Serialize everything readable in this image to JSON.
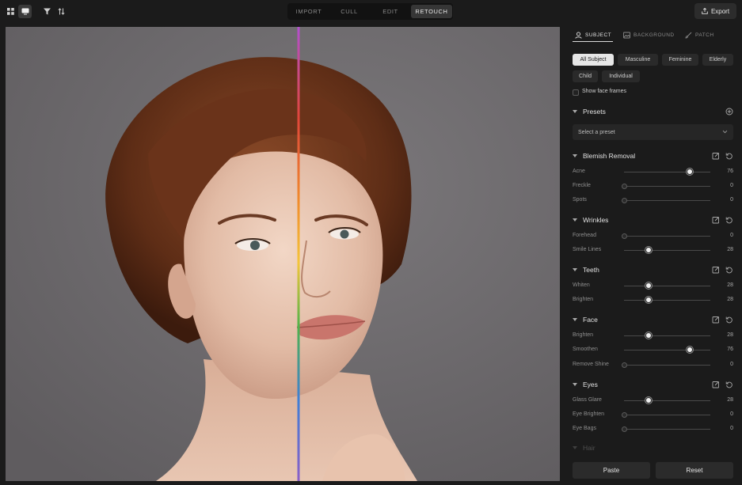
{
  "toolbar": {
    "left_icons": [
      "grid-view-icon",
      "single-view-icon",
      "filter-icon",
      "sort-icon"
    ],
    "modes": [
      {
        "label": "IMPORT",
        "active": false
      },
      {
        "label": "CULL",
        "active": false
      },
      {
        "label": "EDIT",
        "active": false
      },
      {
        "label": "RETOUCH",
        "active": true
      }
    ],
    "export_label": "Export"
  },
  "canvas": {
    "split_line_colors": [
      "#e0463a",
      "#f08a2c",
      "#f4c53a",
      "#4fb34a",
      "#3f7fd6",
      "#8a5fc8"
    ]
  },
  "panel": {
    "tabs": [
      {
        "label": "SUBJECT",
        "icon": "person-icon",
        "active": true
      },
      {
        "label": "BACKGROUND",
        "icon": "image-icon",
        "active": false
      },
      {
        "label": "PATCH",
        "icon": "brush-icon",
        "active": false
      }
    ],
    "subject_chips": [
      {
        "label": "All Subject",
        "active": true
      },
      {
        "label": "Masculine",
        "active": false
      },
      {
        "label": "Feminine",
        "active": false
      },
      {
        "label": "Elderly",
        "active": false
      },
      {
        "label": "Child",
        "active": false
      },
      {
        "label": "Individual",
        "active": false
      }
    ],
    "show_face_frames": "Show face frames",
    "presets": {
      "title": "Presets",
      "placeholder": "Select a preset"
    },
    "sections": [
      {
        "title": "Blemish Removal",
        "rows": [
          {
            "label": "Acne",
            "value": 76
          },
          {
            "label": "Freckle",
            "value": 0
          },
          {
            "label": "Spots",
            "value": 0
          }
        ]
      },
      {
        "title": "Wrinkles",
        "rows": [
          {
            "label": "Forehead",
            "value": 0
          },
          {
            "label": "Smile Lines",
            "value": 28
          }
        ]
      },
      {
        "title": "Teeth",
        "rows": [
          {
            "label": "Whiten",
            "value": 28
          },
          {
            "label": "Brighten",
            "value": 28
          }
        ]
      },
      {
        "title": "Face",
        "rows": [
          {
            "label": "Brighten",
            "value": 28
          },
          {
            "label": "Smoothen",
            "value": 76
          },
          {
            "label": "Remove Shine",
            "value": 0
          }
        ]
      },
      {
        "title": "Eyes",
        "rows": [
          {
            "label": "Glass Glare",
            "value": 28
          },
          {
            "label": "Eye Brighten",
            "value": 0
          },
          {
            "label": "Eye Bags",
            "value": 0
          }
        ]
      }
    ],
    "hair_title": "Hair",
    "paste_label": "Paste",
    "reset_label": "Reset"
  }
}
